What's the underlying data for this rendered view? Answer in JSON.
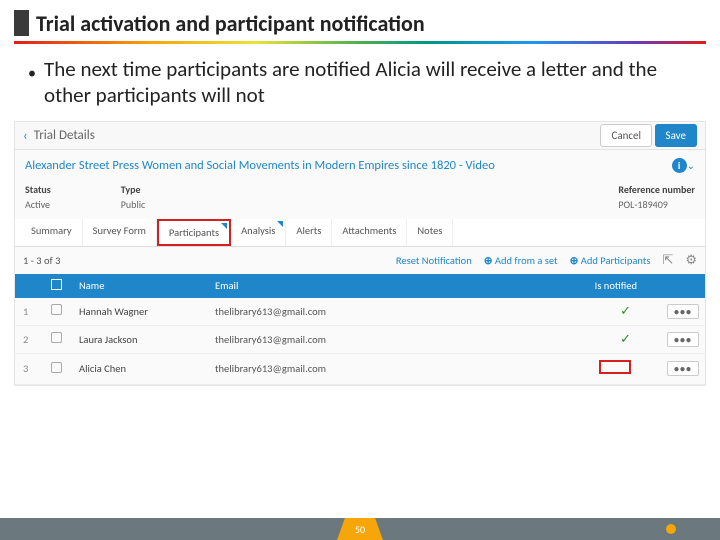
{
  "slide": {
    "title": "Trial activation and participant notification",
    "bullet": "The next time participants are notified Alicia will receive a letter and the other participants will not",
    "page_number": "50"
  },
  "colors": {
    "accent_blue": "#1f87c9",
    "highlight_red": "#d32020",
    "footer_gray": "#6b797f",
    "badge_orange": "#f6a609"
  },
  "app": {
    "breadcrumb": {
      "back_label": "‹",
      "title": "Trial Details"
    },
    "actions": {
      "cancel": "Cancel",
      "save": "Save"
    },
    "record_title": "Alexander Street Press Women and Social Movements in Modern Empires since 1820 - Video",
    "info_icon": "info-icon",
    "meta": {
      "status": {
        "label": "Status",
        "value": "Active"
      },
      "type": {
        "label": "Type",
        "value": "Public"
      },
      "ref": {
        "label": "Reference number",
        "value": "POL-189409"
      }
    },
    "tabs": [
      {
        "label": "Summary",
        "flag": false,
        "highlight": false
      },
      {
        "label": "Survey Form",
        "flag": false,
        "highlight": false
      },
      {
        "label": "Participants",
        "flag": true,
        "highlight": true
      },
      {
        "label": "Analysis",
        "flag": true,
        "highlight": false
      },
      {
        "label": "Alerts",
        "flag": false,
        "highlight": false
      },
      {
        "label": "Attachments",
        "flag": false,
        "highlight": false
      },
      {
        "label": "Notes",
        "flag": false,
        "highlight": false
      }
    ],
    "toolbar": {
      "count_text": "1 - 3 of 3",
      "reset": "Reset Notification",
      "add_set": "Add from a set",
      "add_part": "Add Participants",
      "export_icon": "export-icon",
      "gear_icon": "gear-icon"
    },
    "table": {
      "headers": {
        "name": "Name",
        "email": "Email",
        "notified": "Is notified"
      },
      "rows": [
        {
          "idx": "1",
          "name": "Hannah Wagner",
          "email": "thelibrary613@gmail.com",
          "notified": true,
          "highlight_notified": false
        },
        {
          "idx": "2",
          "name": "Laura Jackson",
          "email": "thelibrary613@gmail.com",
          "notified": true,
          "highlight_notified": false
        },
        {
          "idx": "3",
          "name": "Alicia Chen",
          "email": "thelibrary613@gmail.com",
          "notified": false,
          "highlight_notified": true
        }
      ]
    }
  }
}
